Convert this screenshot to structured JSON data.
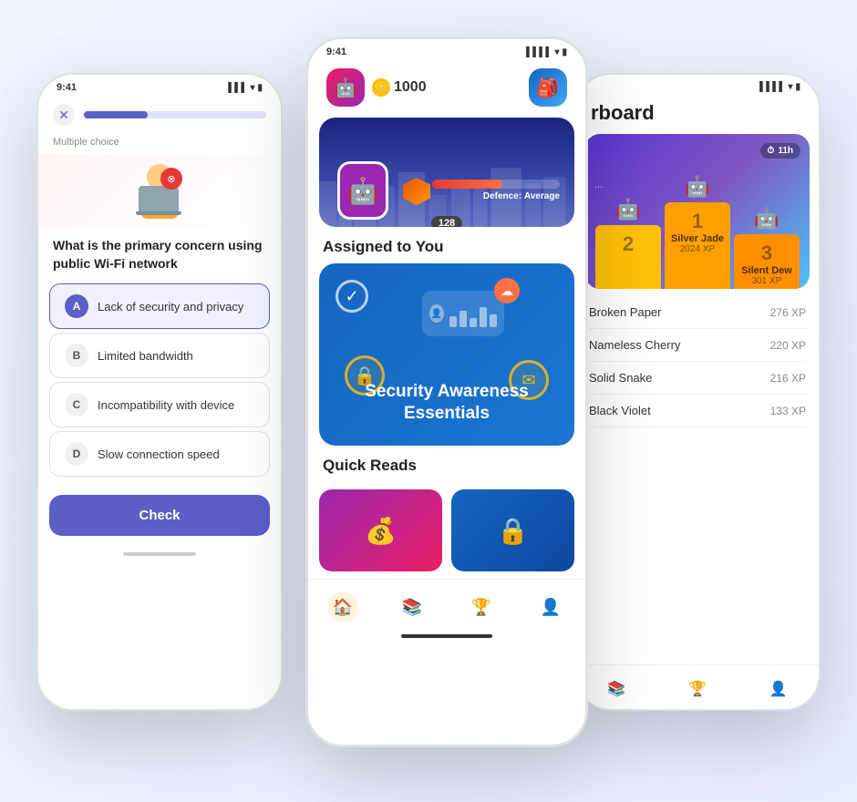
{
  "status_time": "9:41",
  "left_phone": {
    "status_time": "9:41",
    "question_label": "Multiple choice",
    "question_text": "What is the primary concern using public Wi-Fi network",
    "options": [
      {
        "letter": "A",
        "text": "Lack of security and privacy",
        "selected": true
      },
      {
        "letter": "B",
        "text": "Limited bandwidth",
        "selected": false
      },
      {
        "letter": "C",
        "text": "Incompatibility with device",
        "selected": false
      },
      {
        "letter": "D",
        "text": "Slow connection speed",
        "selected": false
      }
    ],
    "check_button": "Check"
  },
  "center_phone": {
    "status_time": "9:41",
    "coins": "1000",
    "assigned_section": "Assigned to You",
    "assignment_title": "Security Awareness Essentials",
    "defence_label": "Defence:",
    "defence_value": "Average",
    "defence_level": "128",
    "quick_reads_title": "Quick Reads",
    "nav_items": [
      "home",
      "book",
      "trophy",
      "profile"
    ]
  },
  "right_phone": {
    "page_title": "rboard",
    "timer": "11h",
    "podium": [
      {
        "rank": "2",
        "name": "...",
        "xp": ""
      },
      {
        "rank": "1",
        "name": "Silver Jade",
        "xp": "2024 XP"
      },
      {
        "rank": "3",
        "name": "Silent Dew",
        "xp": "301 XP"
      }
    ],
    "leaderboard": [
      {
        "name": "Broken Paper",
        "xp": "276 XP"
      },
      {
        "name": "Nameless Cherry",
        "xp": "220 XP"
      },
      {
        "name": "Solid Snake",
        "xp": "216 XP"
      },
      {
        "name": "Black Violet",
        "xp": "133 XP"
      }
    ]
  }
}
